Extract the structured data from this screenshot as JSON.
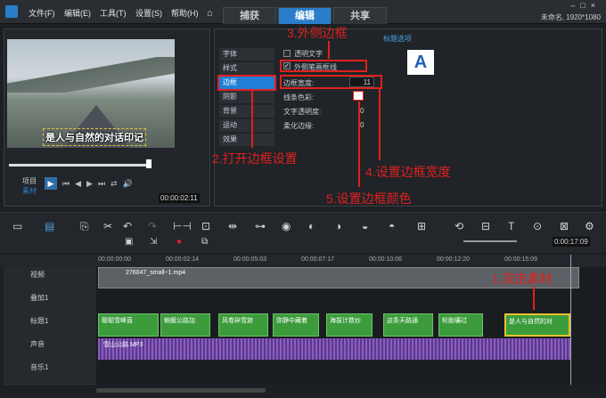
{
  "menu": {
    "file": "文件(F)",
    "edit": "编辑(E)",
    "tools": "工具(T)",
    "settings": "设置(S)",
    "help": "帮助(H)"
  },
  "tabs": [
    "捕获",
    "编辑",
    "共享"
  ],
  "project_info": "未命名, 1920*1080",
  "preview": {
    "caption": "是人与自然的对话印记",
    "mode_project": "项目",
    "mode_clip": "素材",
    "timecode": "00:00:02:11"
  },
  "options": {
    "side_tabs": [
      "字体",
      "样式",
      "边框",
      "阴影",
      "背景",
      "运动",
      "效果"
    ],
    "header": "标题选项",
    "letter": "A",
    "transparent_text": "透明文字",
    "outer_border": "外侧笔画框线",
    "border_width_label": "边框宽度:",
    "border_width_value": "11",
    "line_color_label": "线条色彩:",
    "text_opacity_label": "文字透明度:",
    "text_opacity_value": "0",
    "soft_edge_label": "柔化边缘:",
    "soft_edge_value": "0"
  },
  "annotations": {
    "a1": "1.双击素材",
    "a2": "2.打开边框设置",
    "a3": "3.外侧边框",
    "a4": "4.设置边框宽度",
    "a5": "5.设置边框颜色"
  },
  "timeline": {
    "ruler": [
      "00:00:00:00",
      "00:00:02:14",
      "00:00:05:03",
      "00:00:07:17",
      "00:00:10:06",
      "00:00:12:20",
      "00:00:15:09"
    ],
    "zoom_timecode": "0:00:17:09",
    "tracks": [
      "视频",
      "叠加1",
      "标题1",
      "声音",
      "音乐1"
    ],
    "video_clip": "276047_small~1.mp4",
    "title_clips": [
      "聪聪雪峰直",
      "蜿蜒公路加",
      "风卷碎雪旅",
      "弥静中藏着",
      "海拔计数炒",
      "这条天路通",
      "轮胎碾过",
      "是人与自然的对"
    ],
    "audio_clip": "雪山公路.MP3"
  },
  "colors": {
    "accent": "#1f7fd6",
    "annotation": "#e0201e",
    "title_clip": "#3c9c3c",
    "audio": "#8a5cc2"
  }
}
